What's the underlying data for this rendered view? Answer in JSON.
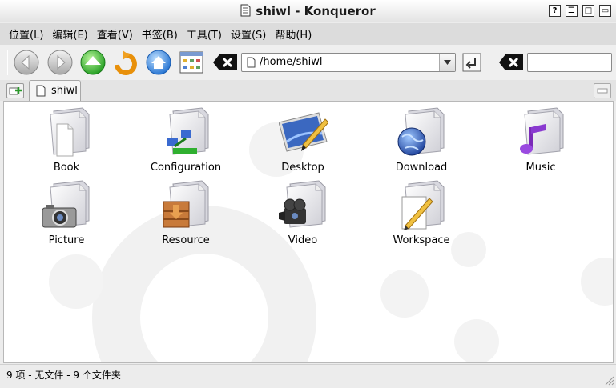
{
  "window": {
    "title": "shiwl - Konqueror",
    "buttons": [
      "?",
      "☰",
      "□",
      "▭"
    ]
  },
  "menu": [
    "位置(L)",
    "编辑(E)",
    "查看(V)",
    "书签(B)",
    "工具(T)",
    "设置(S)",
    "帮助(H)"
  ],
  "toolbar": {
    "icons": [
      "back-icon",
      "forward-icon",
      "up-icon",
      "reload-icon",
      "home-icon",
      "view-mode-icon",
      "clear-location-icon",
      "go-icon",
      "clear-search-icon"
    ],
    "location": "/home/shiwl",
    "search": ""
  },
  "tab": {
    "label": "shiwl"
  },
  "files": [
    {
      "name": "Book"
    },
    {
      "name": "Configuration"
    },
    {
      "name": "Desktop"
    },
    {
      "name": "Download"
    },
    {
      "name": "Music"
    },
    {
      "name": "Picture"
    },
    {
      "name": "Resource"
    },
    {
      "name": "Video"
    },
    {
      "name": "Workspace"
    }
  ],
  "status": "9 项 - 无文件 - 9 个文件夹",
  "colors": {
    "accent": "#2e7bd8",
    "folder": "#e6e6ea",
    "background": "#ffffff"
  }
}
